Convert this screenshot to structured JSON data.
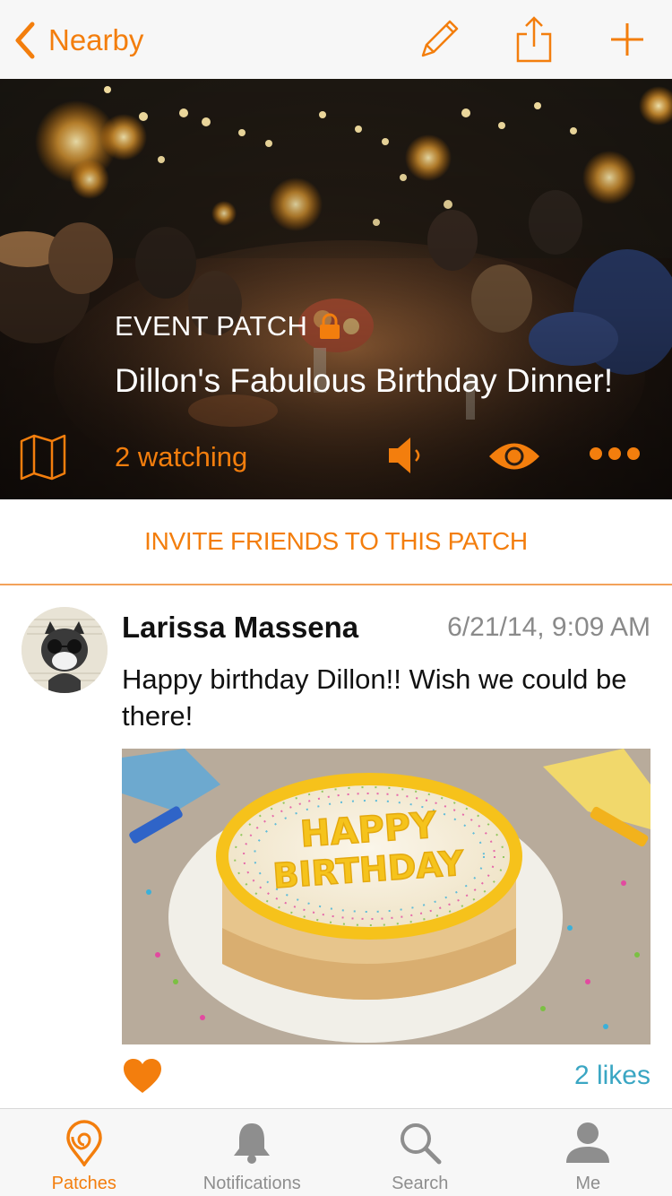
{
  "nav": {
    "back_label": "Nearby",
    "icons": [
      "pencil-icon",
      "share-icon",
      "plus-icon"
    ],
    "accent_color": "#f37e0d"
  },
  "hero": {
    "patch_type": "EVENT PATCH",
    "title": "Dillon's Fabulous Birthday Dinner!",
    "watching_label": "2 watching",
    "icons": [
      "map-icon",
      "lock-icon",
      "speaker-icon",
      "eye-icon",
      "more-icon"
    ]
  },
  "invite": {
    "label": "INVITE FRIENDS TO THIS PATCH"
  },
  "message": {
    "author": "Larissa Massena",
    "timestamp": "6/21/14, 9:09 AM",
    "text": "Happy birthday Dillon!! Wish we could be there!",
    "photo_text": "HAPPY BIRTHDAY",
    "likes_label": "2 likes",
    "likes_color": "#3aa6c3"
  },
  "tabbar": {
    "tabs": [
      {
        "label": "Patches",
        "icon": "patches-icon",
        "active": true
      },
      {
        "label": "Notifications",
        "icon": "bell-icon",
        "active": false
      },
      {
        "label": "Search",
        "icon": "search-icon",
        "active": false
      },
      {
        "label": "Me",
        "icon": "person-icon",
        "active": false
      }
    ],
    "active_color": "#f37e0d",
    "inactive_color": "#8e8e8e"
  }
}
